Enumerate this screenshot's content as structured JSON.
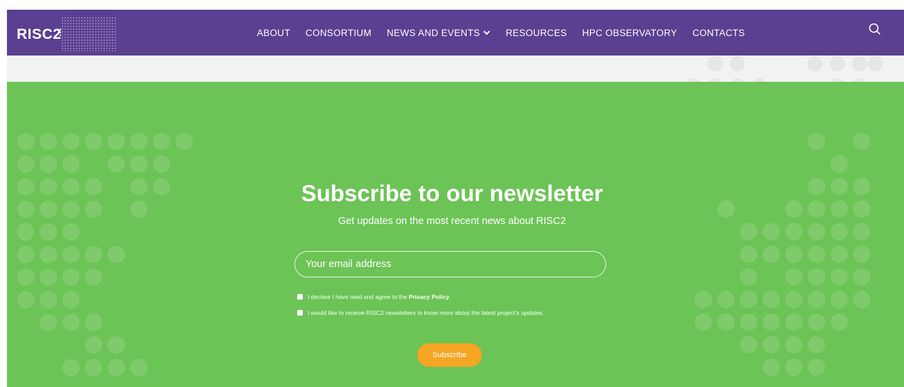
{
  "brand": {
    "logo_text": "RISC2"
  },
  "nav": {
    "items": [
      {
        "label": "ABOUT"
      },
      {
        "label": "CONSORTIUM"
      },
      {
        "label": "NEWS AND EVENTS",
        "has_dropdown": true
      },
      {
        "label": "RESOURCES"
      },
      {
        "label": "HPC OBSERVATORY"
      },
      {
        "label": "CONTACTS"
      }
    ],
    "search_icon": "search-icon",
    "dropdown_icon": "chevron-down-icon"
  },
  "newsletter": {
    "title": "Subscribe to our newsletter",
    "subtitle": "Get updates on the most recent news about RISC2",
    "email_placeholder": "Your email address",
    "checkbox_privacy_prefix": "I declare I have read and agree to the ",
    "checkbox_privacy_link": "Privacy Policy",
    "checkbox_privacy_suffix": ".",
    "checkbox_newsletter": "I would like to receive RISC2 newsletters to know more about the latest project's updates.",
    "subscribe_label": "Subscribe"
  },
  "colors": {
    "nav_bg": "#5b3f91",
    "section_bg": "#6cc356",
    "button_bg": "#f5a623",
    "dot": "#7fcb6b",
    "grey_bar": "#f2f2f2"
  }
}
